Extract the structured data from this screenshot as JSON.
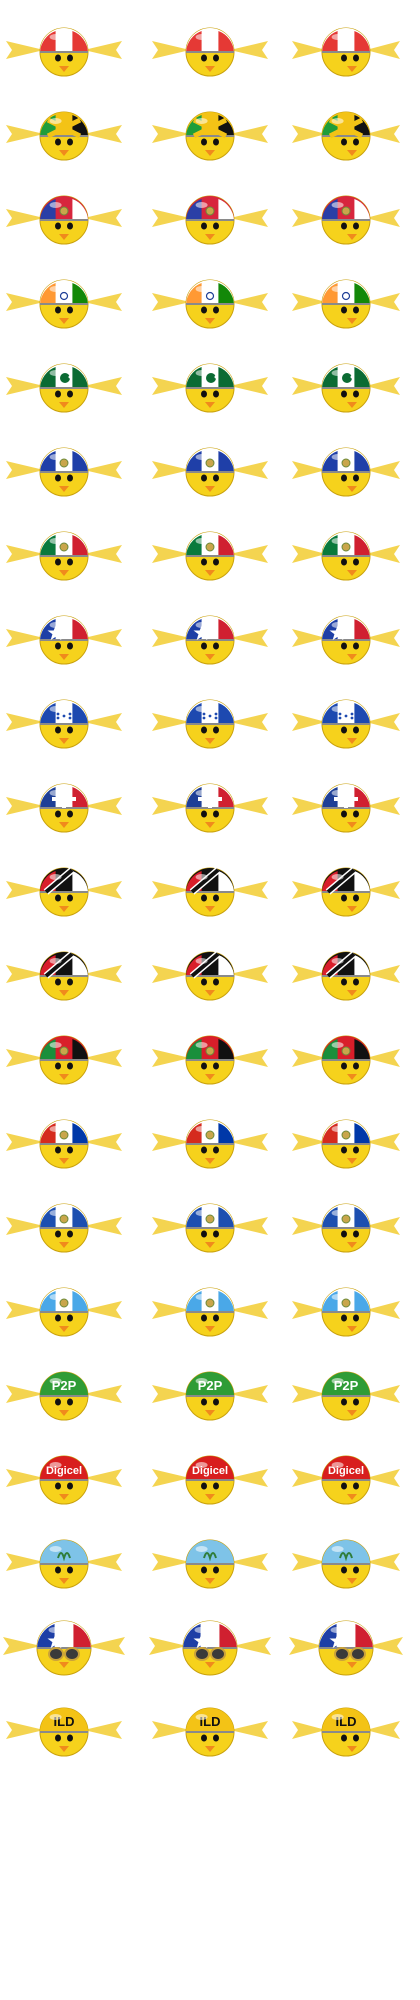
{
  "sheet": {
    "background": "#ffffff",
    "columns": [
      "front view",
      "front view, tilted",
      "side view"
    ],
    "body_color": "#f6d21c",
    "wing_color": "#f3cf3d",
    "beak_color": "#f08a1c",
    "rows": [
      {
        "name": "red-white-stripes",
        "colors": [
          "#e53935",
          "#ffffff",
          "#e53935"
        ],
        "emblem": "none",
        "label": ""
      },
      {
        "name": "jamaica",
        "colors": [
          "#1f9d3a",
          "#f3c316",
          "#111111"
        ],
        "emblem": "saltire",
        "label": ""
      },
      {
        "name": "haiti",
        "colors": [
          "#2a3fa6",
          "#d7263d",
          "#ffffff"
        ],
        "emblem": "coat-of-arms",
        "label": ""
      },
      {
        "name": "india",
        "colors": [
          "#ff9933",
          "#ffffff",
          "#138808"
        ],
        "emblem": "wheel",
        "label": ""
      },
      {
        "name": "pakistan",
        "colors": [
          "#0b6b33",
          "#ffffff",
          "#0b6b33"
        ],
        "emblem": "crescent-star",
        "label": ""
      },
      {
        "name": "el-salvador",
        "colors": [
          "#1f3fa8",
          "#ffffff",
          "#1f3fa8"
        ],
        "emblem": "coat-of-arms",
        "label": ""
      },
      {
        "name": "mexico",
        "colors": [
          "#0a7a3c",
          "#ffffff",
          "#d02030"
        ],
        "emblem": "eagle",
        "label": ""
      },
      {
        "name": "cuba",
        "colors": [
          "#1e3fa6",
          "#ffffff",
          "#d02030"
        ],
        "emblem": "star",
        "label": ""
      },
      {
        "name": "honduras",
        "colors": [
          "#1d49b0",
          "#ffffff",
          "#1d49b0"
        ],
        "emblem": "five-stars",
        "label": ""
      },
      {
        "name": "dominican-republic",
        "colors": [
          "#1e3f96",
          "#ffffff",
          "#d02030"
        ],
        "emblem": "cross",
        "label": ""
      },
      {
        "name": "trinidad-and-tobago",
        "colors": [
          "#d91e2a",
          "#111111",
          "#ffffff"
        ],
        "emblem": "diagonal",
        "label": ""
      },
      {
        "name": "trinidad-and-tobago-alt",
        "colors": [
          "#d91e2a",
          "#111111",
          "#ffffff"
        ],
        "emblem": "diagonal",
        "label": ""
      },
      {
        "name": "red-green-black",
        "colors": [
          "#1a8f3b",
          "#d91e2a",
          "#111111"
        ],
        "emblem": "crest",
        "label": ""
      },
      {
        "name": "paraguay",
        "colors": [
          "#d52b1e",
          "#ffffff",
          "#0038a8"
        ],
        "emblem": "seal",
        "label": ""
      },
      {
        "name": "nicaragua",
        "colors": [
          "#1d4fb0",
          "#ffffff",
          "#1d4fb0"
        ],
        "emblem": "triangle",
        "label": ""
      },
      {
        "name": "guatemala",
        "colors": [
          "#4aa8e8",
          "#ffffff",
          "#4aa8e8"
        ],
        "emblem": "wreath",
        "label": ""
      },
      {
        "name": "p2p",
        "colors": [
          "#2f9c36",
          "#2f9c36",
          "#2f9c36"
        ],
        "emblem": "text",
        "label": "P2P"
      },
      {
        "name": "digicel",
        "colors": [
          "#d81e1e",
          "#d81e1e",
          "#d81e1e"
        ],
        "emblem": "text",
        "label": "Digicel"
      },
      {
        "name": "movistar",
        "colors": [
          "#7ec3e8",
          "#7ec3e8",
          "#7ec3e8"
        ],
        "emblem": "logo",
        "label": ""
      },
      {
        "name": "cuba-goggles",
        "colors": [
          "#1e3fa6",
          "#ffffff",
          "#d02030"
        ],
        "emblem": "star-goggles",
        "label": ""
      },
      {
        "name": "gold-ild",
        "colors": [
          "#f3c316",
          "#f3c316",
          "#f3c316"
        ],
        "emblem": "text",
        "label": "ILD"
      }
    ]
  }
}
